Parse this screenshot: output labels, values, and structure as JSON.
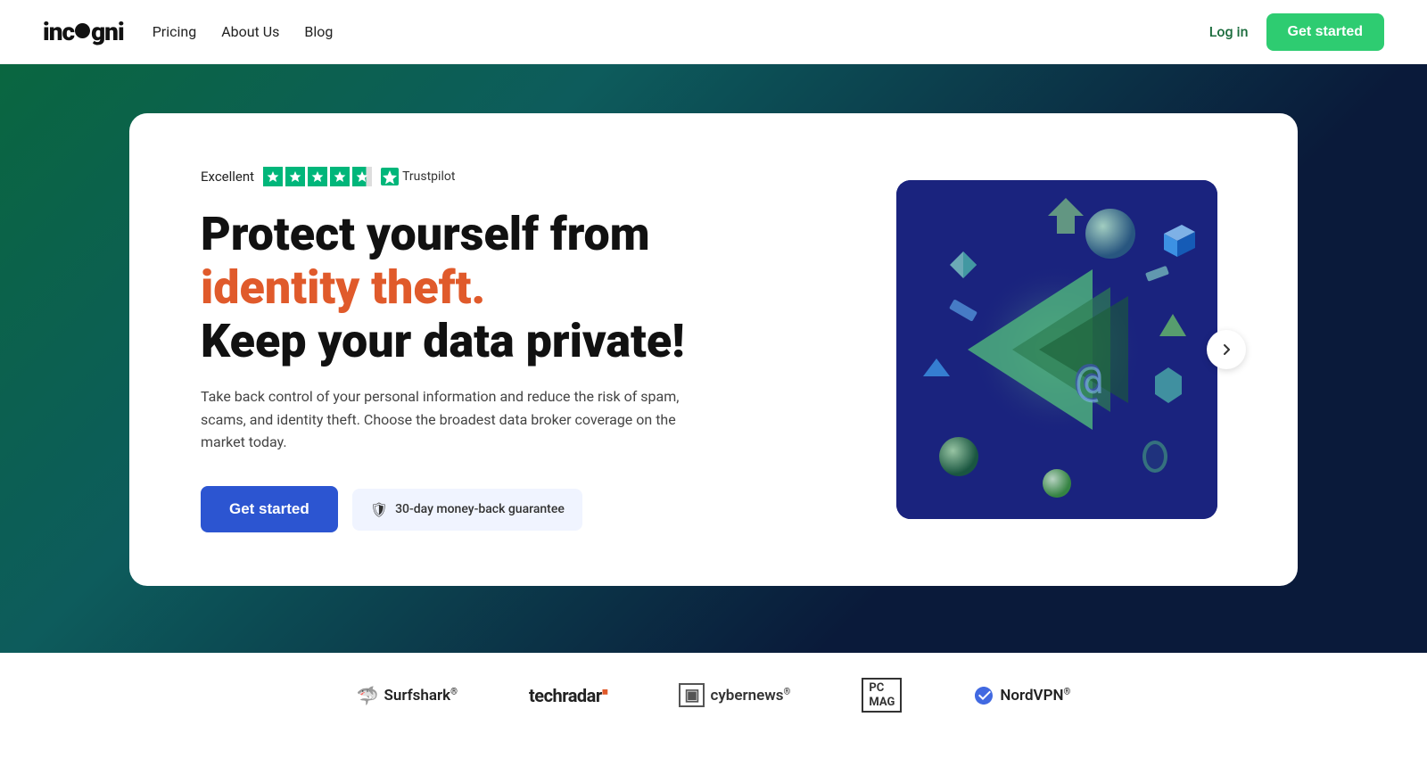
{
  "navbar": {
    "logo": "incogni",
    "links": [
      {
        "label": "Pricing",
        "href": "#"
      },
      {
        "label": "About Us",
        "href": "#"
      },
      {
        "label": "Blog",
        "href": "#"
      }
    ],
    "login_label": "Log in",
    "get_started_label": "Get started"
  },
  "hero": {
    "trustpilot": {
      "label": "Excellent",
      "tp_label": "Trustpilot"
    },
    "title_part1": "Protect yourself from ",
    "title_highlight": "identity theft.",
    "title_part2": "Keep your data private!",
    "subtitle": "Take back control of your personal information and reduce the risk of spam, scams, and identity theft. Choose the broadest data broker coverage on the market today.",
    "cta_label": "Get started",
    "money_back_label": "30-day money-back guarantee"
  },
  "brands": [
    {
      "name": "Surfshark",
      "symbol": "🦈"
    },
    {
      "name": "techradar",
      "symbol": ""
    },
    {
      "name": "cybernews",
      "symbol": "▣"
    },
    {
      "name": "PC Mag",
      "symbol": ""
    },
    {
      "name": "NordVPN",
      "symbol": "🌐"
    }
  ],
  "colors": {
    "accent_green": "#2ecc71",
    "accent_blue": "#2c55d1",
    "accent_orange": "#e05a2b",
    "dark_navy": "#1a237e",
    "trustpilot_green": "#00b67a"
  }
}
